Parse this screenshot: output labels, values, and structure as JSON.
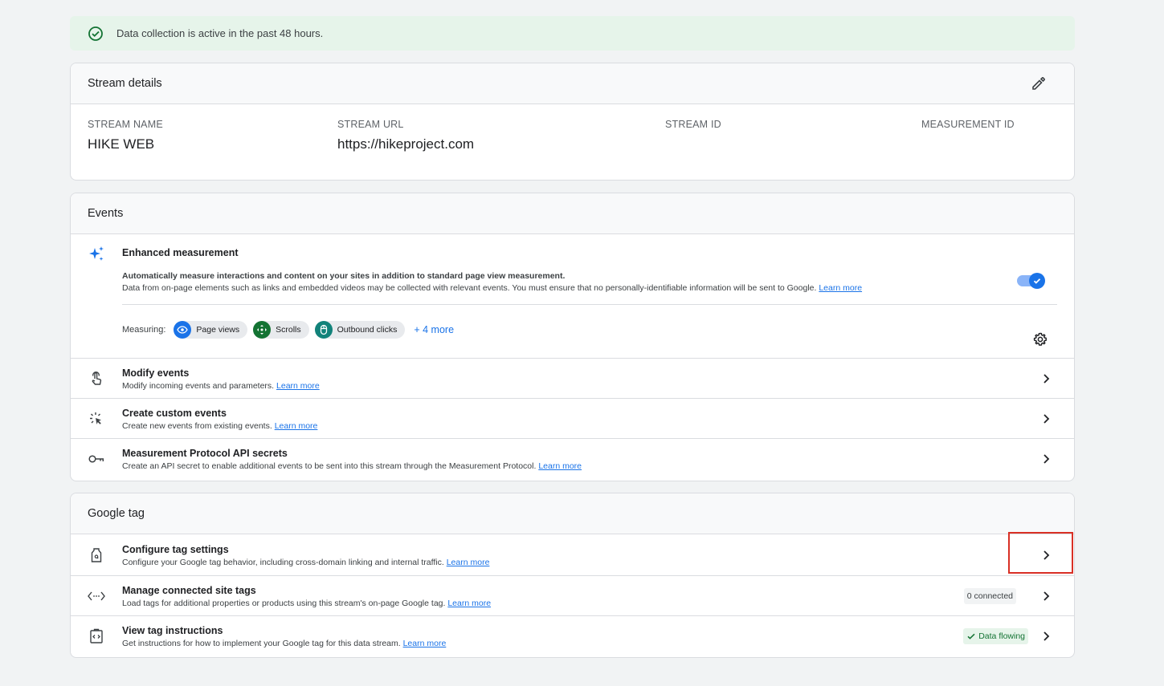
{
  "banner": {
    "text": "Data collection is active in the past 48 hours.",
    "icon": "check-circle-icon"
  },
  "stream_details": {
    "title": "Stream details",
    "fields": [
      {
        "label": "STREAM NAME",
        "value": "HIKE WEB"
      },
      {
        "label": "STREAM URL",
        "value": "https://hikeproject.com"
      },
      {
        "label": "STREAM ID",
        "value": ""
      },
      {
        "label": "MEASUREMENT ID",
        "value": ""
      }
    ]
  },
  "events": {
    "title": "Events",
    "enhanced": {
      "title": "Enhanced measurement",
      "desc_bold": "Automatically measure interactions and content on your sites in addition to standard page view measurement.",
      "desc": "Data from on-page elements such as links and embedded videos may be collected with relevant events. You must ensure that no personally-identifiable information will be sent to Google.",
      "learn_more": "Learn more",
      "toggle_on": true,
      "measuring_label": "Measuring:",
      "chips": [
        {
          "label": "Page views",
          "color": "#1a73e8"
        },
        {
          "label": "Scrolls",
          "color": "#137333"
        },
        {
          "label": "Outbound clicks",
          "color": "#12827a"
        }
      ],
      "more": "+ 4 more"
    },
    "rows": [
      {
        "title": "Modify events",
        "desc": "Modify incoming events and parameters.",
        "learn_more": "Learn more",
        "icon": "touch-icon"
      },
      {
        "title": "Create custom events",
        "desc": "Create new events from existing events.",
        "learn_more": "Learn more",
        "icon": "click-sparkle-icon"
      },
      {
        "title": "Measurement Protocol API secrets",
        "desc": "Create an API secret to enable additional events to be sent into this stream through the Measurement Protocol.",
        "learn_more": "Learn more",
        "icon": "key-icon"
      }
    ]
  },
  "google_tag": {
    "title": "Google tag",
    "rows": [
      {
        "title": "Configure tag settings",
        "desc": "Configure your Google tag behavior, including cross-domain linking and internal traffic.",
        "learn_more": "Learn more",
        "icon": "tag-icon"
      },
      {
        "title": "Manage connected site tags",
        "desc": "Load tags for additional properties or products using this stream's on-page Google tag.",
        "learn_more": "Learn more",
        "icon": "code-arrows-icon",
        "badge": "0 connected"
      },
      {
        "title": "View tag instructions",
        "desc": "Get instructions for how to implement your Google tag for this data stream.",
        "learn_more": "Learn more",
        "icon": "clipboard-code-icon",
        "badge": "Data flowing"
      }
    ]
  }
}
